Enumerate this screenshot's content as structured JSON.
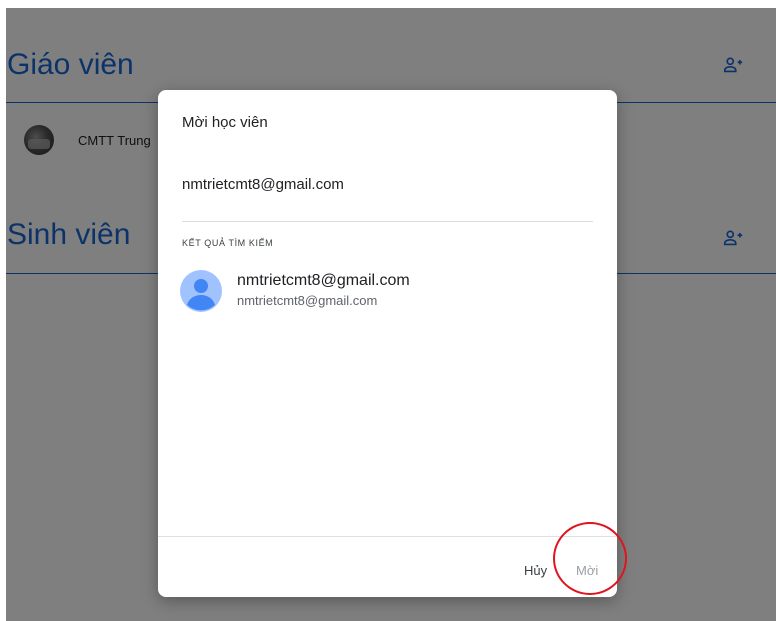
{
  "background": {
    "teachers_section": {
      "title": "Giáo viên",
      "add_icon": "person-add-icon"
    },
    "teacher_row": {
      "name": "CMTT Trung"
    },
    "students_section": {
      "title": "Sinh viên",
      "add_icon": "person-add-icon"
    }
  },
  "dialog": {
    "title": "Mời học viên",
    "input_value": "nmtrietcmt8@gmail.com",
    "results_heading": "KẾT QUẢ TÌM KIẾM",
    "result": {
      "name": "nmtrietcmt8@gmail.com",
      "email": "nmtrietcmt8@gmail.com",
      "avatar_icon": "default-avatar-icon"
    },
    "cancel_label": "Hủy",
    "invite_label": "Mời"
  },
  "colors": {
    "accent": "#1967d2",
    "scrim": "rgba(0,0,0,0.5)",
    "annotation": "#e0141e",
    "disabled_text": "#9aa0a6"
  }
}
